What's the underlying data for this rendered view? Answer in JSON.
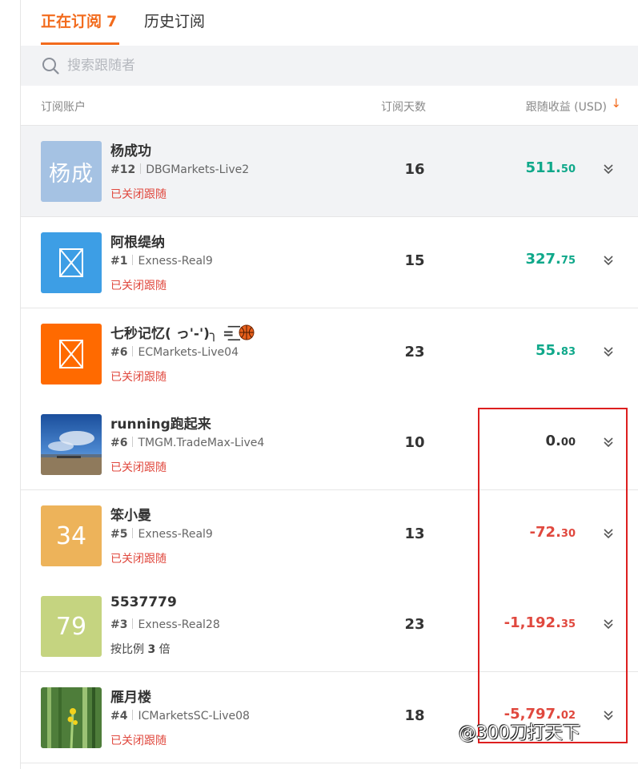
{
  "tabs": {
    "active_label": "正在订阅",
    "active_count": "7",
    "inactive_label": "历史订阅"
  },
  "search": {
    "placeholder": "搜索跟随者"
  },
  "columns": {
    "account": "订阅账户",
    "days": "订阅天数",
    "profit": "跟随收益 (USD)",
    "sort_icon": "arrow-down-icon"
  },
  "rows": [
    {
      "name": "杨成功",
      "rank": "#12",
      "broker": "DBGMarkets-Live2",
      "status": "已关闭跟随",
      "days": "16",
      "profit_int": "511.",
      "profit_dec": "50",
      "avatar_text": "杨成",
      "avatar_color": "#a5c2e3"
    },
    {
      "name": "阿根缇纳",
      "rank": "#1",
      "broker": "Exness-Real9",
      "status": "已关闭跟随",
      "days": "15",
      "profit_int": "327.",
      "profit_dec": "75",
      "avatar_icon": "broken-image-icon",
      "avatar_color": "#3d9ee5"
    },
    {
      "name": "七秒记忆( っ'-')╮ =͟͟͞͞",
      "rank": "#6",
      "broker": "ECMarkets-Live04",
      "status": "已关闭跟随",
      "days": "23",
      "profit_int": "55.",
      "profit_dec": "83",
      "avatar_icon": "broken-image-icon",
      "avatar_color": "#ff6a00"
    },
    {
      "name": "running跑起来",
      "rank": "#6",
      "broker": "TMGM.TradeMax-Live4",
      "status": "已关闭跟随",
      "days": "10",
      "profit_int": "0.",
      "profit_dec": "00",
      "avatar_icon": "beach-photo-avatar"
    },
    {
      "name": "笨小曼",
      "rank": "#5",
      "broker": "Exness-Real9",
      "status": "已关闭跟随",
      "days": "13",
      "profit_int": "-72.",
      "profit_dec": "30",
      "avatar_text": "34",
      "avatar_color": "#edb35a"
    },
    {
      "name": "5537779",
      "rank": "#3",
      "broker": "Exness-Real28",
      "status_prefix": "按比例",
      "status_num": "3",
      "status_suffix": "倍",
      "days": "23",
      "profit_int": "-1,192.",
      "profit_dec": "35",
      "avatar_text": "79",
      "avatar_color": "#c5d480"
    },
    {
      "name": "雁月楼",
      "rank": "#4",
      "broker": "ICMarketsSC-Live08",
      "status": "已关闭跟随",
      "days": "18",
      "profit_int": "-5,797.",
      "profit_dec": "02",
      "avatar_icon": "flower-photo-avatar"
    }
  ],
  "colors": {
    "accent": "#f26b1d",
    "positive": "#0fa88a",
    "negative": "#e0483e",
    "highlight_box": "#dd1f1f"
  },
  "watermark": "@300刀打天下"
}
